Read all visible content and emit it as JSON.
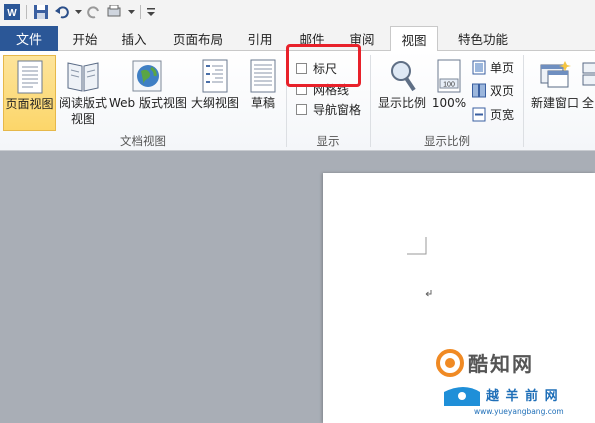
{
  "tabs": {
    "file": "文件",
    "items": [
      "开始",
      "插入",
      "页面布局",
      "引用",
      "邮件",
      "审阅",
      "视图",
      "特色功能"
    ]
  },
  "ribbon": {
    "document_views": {
      "label": "文档视图",
      "print_layout": "页面视图",
      "reading_line1": "阅读版式",
      "reading_line2": "视图",
      "web_layout": "Web 版式视图",
      "outline": "大纲视图",
      "draft": "草稿"
    },
    "show": {
      "label": "显示",
      "ruler": "标尺",
      "gridlines": "网格线",
      "navigation_pane": "导航窗格"
    },
    "zoom": {
      "label": "显示比例",
      "zoom": "显示比例",
      "hundred": "100%",
      "one_page": "单页",
      "two_pages": "双页",
      "page_width": "页宽"
    },
    "window": {
      "new_window": "新建窗口",
      "arrange_all": "全"
    }
  },
  "watermark": {
    "brand": "酷知网",
    "site_name": "越 羊 前 网",
    "url": "www.yueyangbang.com"
  },
  "colors": {
    "file_tab": "#2b5797",
    "highlight": "#e8212a",
    "selected_btn": "#fcd66a"
  }
}
